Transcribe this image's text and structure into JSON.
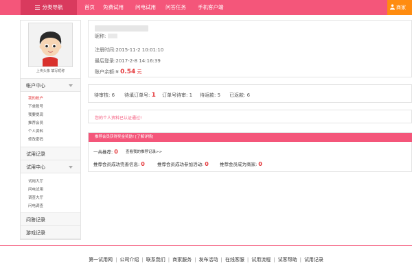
{
  "nav": {
    "category": "分类导航",
    "links": [
      "首页",
      "免费试用",
      "问电试用",
      "问答任务",
      "手机客户端"
    ],
    "merchant": "商家"
  },
  "sidebar": {
    "avatar_caption": "上传头像 填写昵称",
    "account_center": "帐户中心",
    "account_items": [
      "我的帐户",
      "下单账号",
      "我要提现",
      "推荐会员",
      "个人资料",
      "修改密码"
    ],
    "trial_records": "试用记录",
    "trial_center": "试用中心",
    "trial_items": [
      "试用大厅",
      "问电试用",
      "调查大厅",
      "问电调查"
    ],
    "qa_records": "问答记录",
    "game_records": "游戏记录"
  },
  "profile": {
    "nickname_label": "昵称:",
    "reg_label": "注册时间:",
    "reg_time": "2015-11-2 10:01:10",
    "last_label": "最后登录:",
    "last_time": "2017-2-8 14:16:39",
    "balance_label": "账户余额:",
    "currency": "¥",
    "balance": "0.54",
    "unit": "元"
  },
  "stats": [
    {
      "label": "待审核:",
      "value": "6",
      "hot": false
    },
    {
      "label": "待填订单号:",
      "value": "1",
      "hot": true
    },
    {
      "label": "订单号待审:",
      "value": "1",
      "hot": false
    },
    {
      "label": "待返款:",
      "value": "5",
      "hot": false
    },
    {
      "label": "已返款:",
      "value": "6",
      "hot": false
    }
  ],
  "notice": "您的个人资料已认证通过!",
  "recommend": {
    "banner": "推荐会员获得奖金奖励! [了解详情]",
    "total_label": "一共推荐:",
    "total": "0",
    "view_link": "查看我的推荐记录>>",
    "info_label": "推荐会员成功完善信息:",
    "info": "0",
    "activity_label": "推荐会员成功参加活动:",
    "activity": "0",
    "merchant_label": "推荐会员成为商家:",
    "merchant": "0"
  },
  "footer": [
    "第一试用网",
    "公司介绍",
    "联系我们",
    "商家服务",
    "发布活动",
    "在线客服",
    "试用流程",
    "试客帮助",
    "试用记录"
  ],
  "colors": {
    "brand": "#f4567a",
    "accent": "#ff8c10",
    "highlight": "#e4393c"
  }
}
